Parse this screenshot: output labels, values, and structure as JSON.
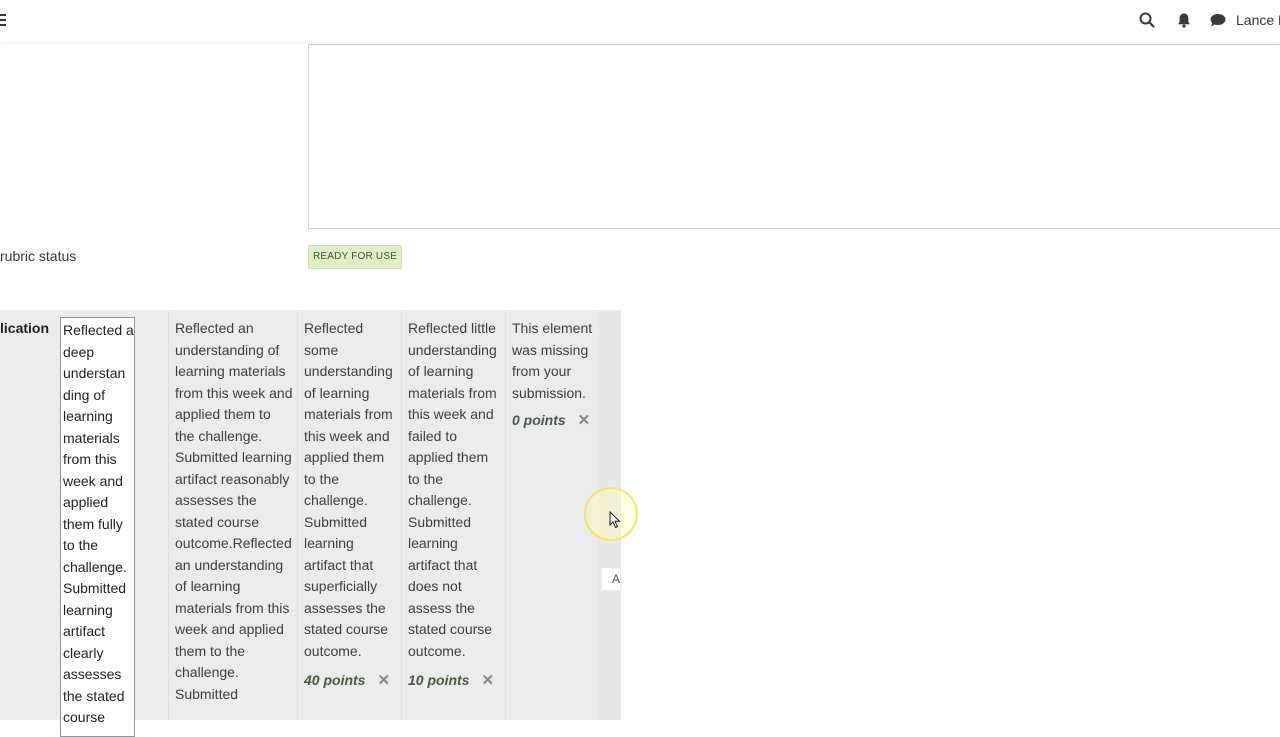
{
  "navbar": {
    "user_name": "Lance B",
    "icons": [
      "menu-icon",
      "search-icon",
      "bell-icon",
      "chat-icon"
    ]
  },
  "rubric_status": {
    "label": "rubric status",
    "badge": "READY FOR USE"
  },
  "criterion": {
    "name": "lication",
    "levels": [
      {
        "description": "Reflected a deep understan ding of learning materials from this week and applied them fully to the challenge. Submitted learning artifact clearly assesses the stated course"
      },
      {
        "description": "Reflected an understanding of learning materials from this week and applied them to the challenge. Submitted learning artifact reasonably assesses the stated course outcome.Reflected an understanding of learning materials from this week and applied them to the challenge. Submitted"
      },
      {
        "description": "Reflected some understanding of learning materials from this week and applied them to the challenge. Submitted learning artifact that superficially assesses the stated course outcome.",
        "points": "40 points"
      },
      {
        "description": "Reflected little understanding of learning materials from this week and failed to applied them to the challenge. Submitted learning artifact that does not assess the stated course outcome.",
        "points": "10 points"
      },
      {
        "description": "This element was missing from your submission.",
        "points": "0 points"
      }
    ],
    "add_level_label": "A"
  },
  "colors": {
    "badge_bg": "#dff0c8",
    "rubric_bg": "#ececec",
    "points_text": "#4a5a45"
  }
}
